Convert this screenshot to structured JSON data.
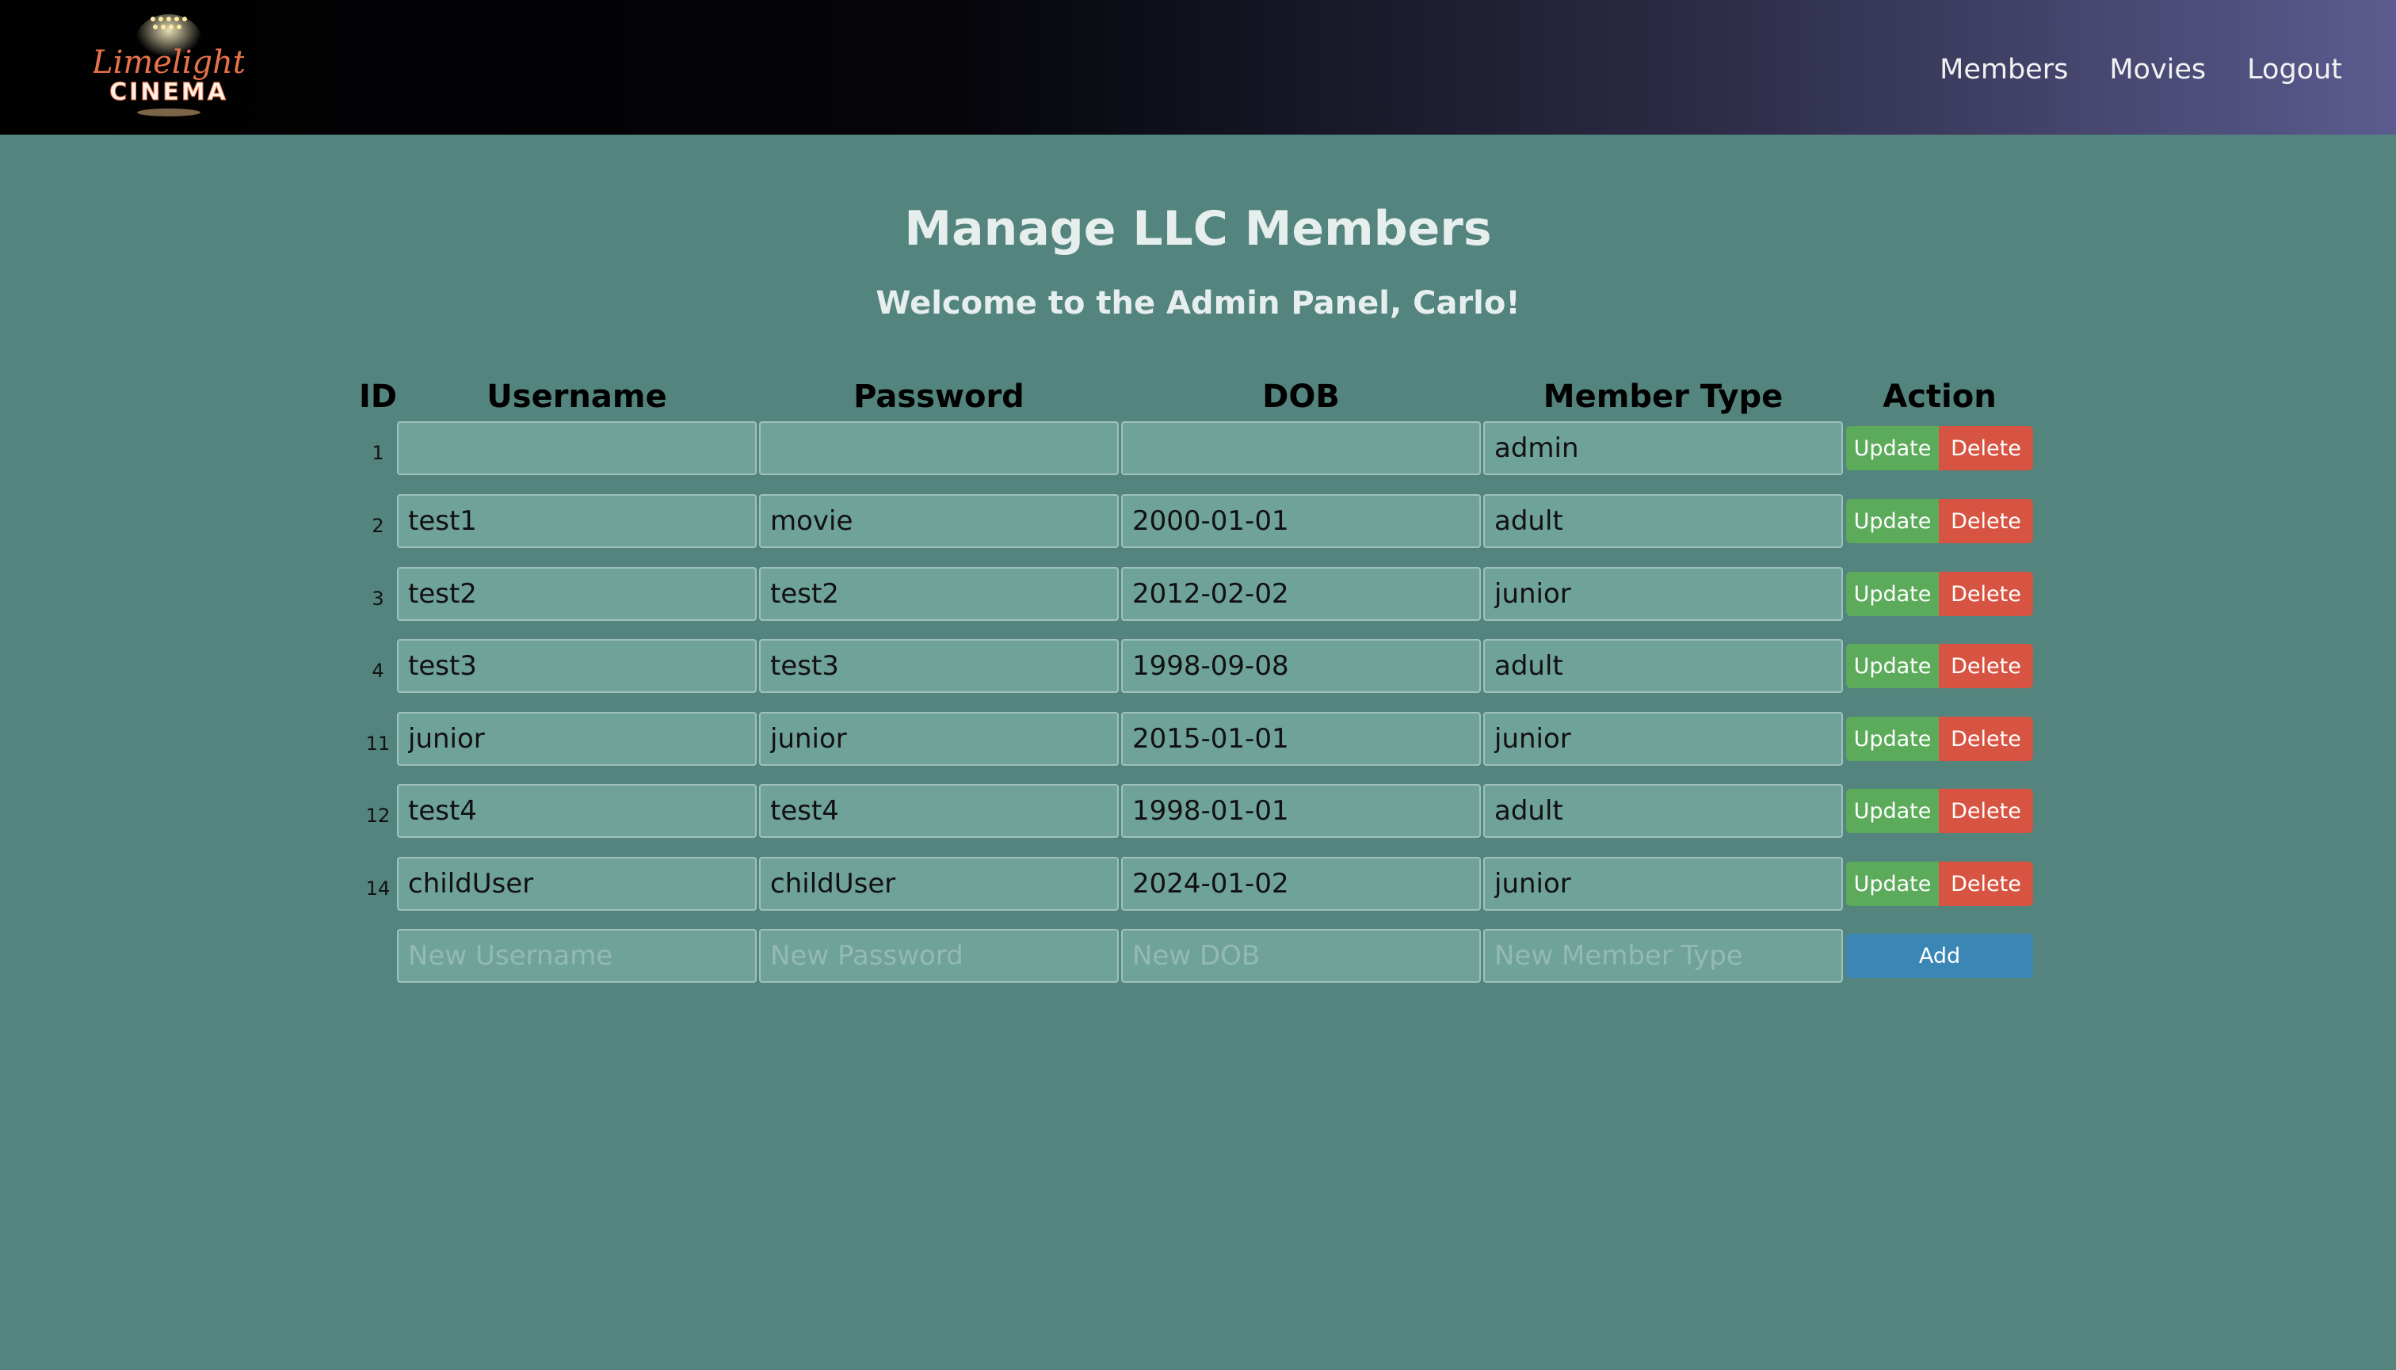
{
  "header": {
    "logo": {
      "text_script": "Limelight",
      "text_caps": "CINEMA"
    },
    "nav": [
      {
        "label": "Members"
      },
      {
        "label": "Movies"
      },
      {
        "label": "Logout"
      }
    ]
  },
  "page": {
    "title": "Manage LLC Members",
    "welcome": "Welcome to the Admin Panel, Carlo!"
  },
  "table": {
    "headers": {
      "id": "ID",
      "username": "Username",
      "password": "Password",
      "dob": "DOB",
      "member_type": "Member Type",
      "action": "Action"
    },
    "update_label": "Update",
    "delete_label": "Delete",
    "rows": [
      {
        "id": "1",
        "username": "",
        "password": "",
        "dob": "",
        "member_type": "admin"
      },
      {
        "id": "2",
        "username": "test1",
        "password": "movie",
        "dob": "2000-01-01",
        "member_type": "adult"
      },
      {
        "id": "3",
        "username": "test2",
        "password": "test2",
        "dob": "2012-02-02",
        "member_type": "junior"
      },
      {
        "id": "4",
        "username": "test3",
        "password": "test3",
        "dob": "1998-09-08",
        "member_type": "adult"
      },
      {
        "id": "11",
        "username": "junior",
        "password": "junior",
        "dob": "2015-01-01",
        "member_type": "junior"
      },
      {
        "id": "12",
        "username": "test4",
        "password": "test4",
        "dob": "1998-01-01",
        "member_type": "adult"
      },
      {
        "id": "14",
        "username": "childUser",
        "password": "childUser",
        "dob": "2024-01-02",
        "member_type": "junior"
      }
    ],
    "new_row": {
      "username_placeholder": "New Username",
      "password_placeholder": "New Password",
      "dob_placeholder": "New DOB",
      "member_type_placeholder": "New Member Type",
      "add_label": "Add"
    }
  },
  "colors": {
    "background": "#53847d",
    "input_bg": "#6fa299",
    "update_button": "#5cab5b",
    "delete_button": "#d85442",
    "add_button": "#3a87b6"
  }
}
